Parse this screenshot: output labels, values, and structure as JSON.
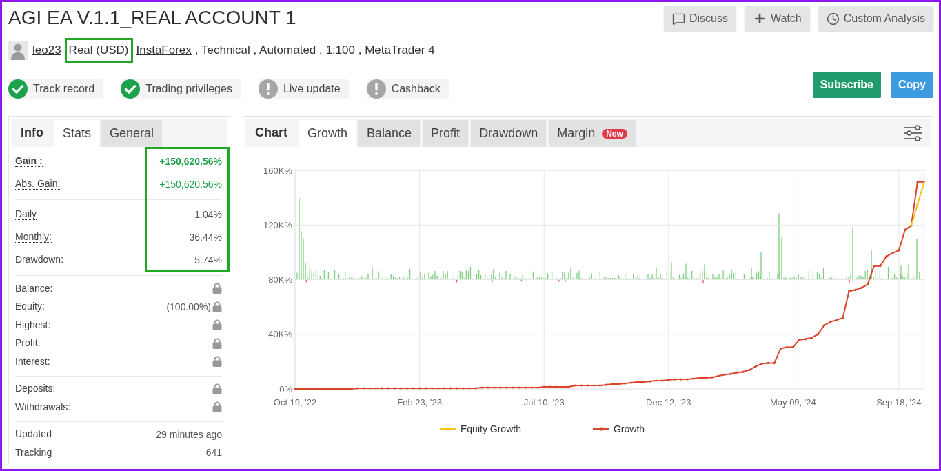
{
  "title": "AGI EA V.1.1_REAL ACCOUNT 1",
  "header_buttons": [
    {
      "label": "Discuss"
    },
    {
      "label": "Watch"
    },
    {
      "label": "Custom Analysis"
    }
  ],
  "meta": [
    {
      "kind": "link",
      "text": "leo23",
      "highlighted": false
    },
    {
      "kind": "text",
      "text": "Real (USD)",
      "highlighted": true
    },
    {
      "kind": "link",
      "text": "InstaForex",
      "highlighted": false
    },
    {
      "kind": "text",
      "text": ", Technical , Automated , 1:100 , MetaTrader 4",
      "highlighted": false
    }
  ],
  "badges": [
    {
      "label": "Track record",
      "verified": true
    },
    {
      "label": "Trading privileges",
      "verified": true
    },
    {
      "label": "Live update",
      "verified": false
    },
    {
      "label": "Cashback",
      "verified": false
    }
  ],
  "actions": [
    {
      "label": "Subscribe",
      "color": "#1f9b6c"
    },
    {
      "label": "Copy",
      "color": "#3d9be0"
    }
  ],
  "info_panel": {
    "title": "Info",
    "tabs": [
      {
        "label": "Stats",
        "selected": true
      },
      {
        "label": "General",
        "selected": false
      }
    ],
    "groups": [
      {
        "highlighted": true,
        "rows": [
          {
            "label": "Gain :",
            "value": "+150,620.56%",
            "color": "#1f9f49",
            "bold": true,
            "dotted": true,
            "locked": false
          },
          {
            "label": "Abs. Gain:",
            "value": "+150,620.56%",
            "color": "#1f9f49",
            "bold": false,
            "dotted": true,
            "locked": false
          }
        ]
      },
      {
        "highlighted": true,
        "rows": [
          {
            "label": "Daily",
            "value": "1.04%",
            "color": "#555555",
            "bold": false,
            "dotted": true,
            "locked": false
          },
          {
            "label": "Monthly:",
            "value": "36.44%",
            "color": "#555555",
            "bold": false,
            "dotted": true,
            "locked": false
          },
          {
            "label": "Drawdown:",
            "value": "5.74%",
            "color": "#555555",
            "bold": false,
            "dotted": false,
            "locked": false
          }
        ]
      },
      {
        "highlighted": false,
        "rows": [
          {
            "label": "Balance:",
            "bold": false,
            "dotted": false,
            "locked": true
          },
          {
            "label": "Equity:",
            "value": "(100.00%)",
            "color": "#555555",
            "bold": false,
            "dotted": false,
            "locked": true
          },
          {
            "label": "Highest:",
            "bold": false,
            "dotted": false,
            "locked": true
          },
          {
            "label": "Profit:",
            "bold": false,
            "dotted": false,
            "locked": true
          },
          {
            "label": "Interest:",
            "bold": false,
            "dotted": false,
            "locked": true
          }
        ]
      },
      {
        "highlighted": false,
        "rows": [
          {
            "label": "Deposits:",
            "bold": false,
            "dotted": false,
            "locked": true
          },
          {
            "label": "Withdrawals:",
            "bold": false,
            "dotted": false,
            "locked": true
          }
        ]
      },
      {
        "highlighted": false,
        "rows": [
          {
            "label": "Updated",
            "value": "29 minutes ago",
            "color": "#555555",
            "bold": false,
            "dotted": false,
            "locked": false
          },
          {
            "label": "Tracking",
            "value": "641",
            "color": "#555555",
            "bold": false,
            "dotted": false,
            "locked": false
          }
        ]
      }
    ]
  },
  "chart_panel": {
    "title": "Chart",
    "tabs": [
      {
        "label": "Growth",
        "selected": true
      },
      {
        "label": "Balance",
        "selected": false
      },
      {
        "label": "Profit",
        "selected": false
      },
      {
        "label": "Drawdown",
        "selected": false
      },
      {
        "label": "Margin",
        "selected": false,
        "badge": "New"
      }
    ],
    "chart_data": {
      "type": "line",
      "grid": true,
      "ylim": [
        0,
        160000
      ],
      "yticks": [
        {
          "value": 0,
          "label": "0%"
        },
        {
          "value": 40000,
          "label": "40K%"
        },
        {
          "value": 80000,
          "label": "80K%"
        },
        {
          "value": 120000,
          "label": "120K%"
        },
        {
          "value": 160000,
          "label": "160K%"
        }
      ],
      "categories": [
        "Oct 19, '22",
        null,
        null,
        null,
        null,
        null,
        null,
        null,
        null,
        null,
        null,
        null,
        null,
        null,
        null,
        null,
        null,
        null,
        null,
        null,
        "Feb 23, '23",
        null,
        null,
        null,
        null,
        null,
        null,
        null,
        null,
        null,
        null,
        null,
        null,
        null,
        null,
        null,
        null,
        null,
        null,
        null,
        "Jul 10, '23",
        null,
        null,
        null,
        null,
        null,
        null,
        null,
        null,
        null,
        null,
        null,
        null,
        null,
        null,
        null,
        null,
        null,
        null,
        null,
        "Dec 12, '23",
        null,
        null,
        null,
        null,
        null,
        null,
        null,
        null,
        null,
        null,
        null,
        null,
        null,
        null,
        null,
        null,
        null,
        null,
        null,
        "May 09, '24",
        null,
        null,
        null,
        null,
        null,
        null,
        null,
        null,
        null,
        null,
        null,
        null,
        null,
        null,
        null,
        null,
        "Sep 18, '24",
        null,
        null,
        null,
        null
      ],
      "series": [
        {
          "name": "Equity Growth",
          "color": "#f0c419",
          "values": [
            null,
            null,
            null,
            null,
            null,
            null,
            null,
            null,
            null,
            null,
            null,
            null,
            null,
            null,
            null,
            null,
            null,
            null,
            null,
            null,
            null,
            null,
            null,
            null,
            null,
            null,
            null,
            null,
            null,
            null,
            null,
            null,
            null,
            null,
            null,
            null,
            null,
            null,
            null,
            null,
            null,
            null,
            null,
            null,
            null,
            null,
            null,
            null,
            null,
            null,
            null,
            null,
            null,
            null,
            null,
            null,
            null,
            null,
            null,
            null,
            null,
            null,
            null,
            null,
            null,
            null,
            null,
            null,
            null,
            null,
            null,
            null,
            null,
            null,
            null,
            null,
            null,
            null,
            null,
            null,
            null,
            null,
            null,
            null,
            null,
            null,
            null,
            null,
            null,
            null,
            null,
            null,
            null,
            null,
            null,
            null,
            null,
            null,
            null,
            119500,
            135000,
            150500
          ]
        },
        {
          "name": "Growth",
          "color": "#d9442b",
          "values": [
            0,
            0,
            0,
            0,
            0,
            0,
            0,
            0,
            0,
            0,
            500,
            500,
            500,
            500,
            500,
            500,
            500,
            500,
            500,
            500,
            500,
            500,
            500,
            500,
            500,
            500,
            500,
            500,
            500,
            500,
            1000,
            1000,
            1000,
            1000,
            1000,
            1000,
            1000,
            1000,
            1000,
            1000,
            1500,
            1500,
            1500,
            1500,
            1500,
            2500,
            2500,
            2500,
            2500,
            2500,
            3000,
            3500,
            3500,
            4000,
            4500,
            5000,
            5000,
            5500,
            6000,
            6000,
            6500,
            7000,
            7000,
            7000,
            7500,
            8000,
            8000,
            8500,
            9500,
            10500,
            11000,
            12000,
            12500,
            14000,
            16500,
            18500,
            19000,
            19000,
            29500,
            30500,
            30500,
            36000,
            36500,
            37500,
            40000,
            46500,
            49000,
            50500,
            52000,
            71500,
            72500,
            74000,
            76500,
            90000,
            90000,
            97000,
            99500,
            101500,
            116500,
            119500,
            151500,
            151500
          ]
        }
      ]
    }
  }
}
